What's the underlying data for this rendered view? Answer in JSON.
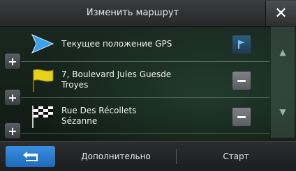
{
  "header": {
    "title": "Изменить маршрут",
    "close_label": "✕"
  },
  "route": {
    "points": [
      {
        "line1": "Текущее положение GPS",
        "line2": "",
        "icon": "gps-arrow-icon",
        "action": "flag-icon"
      },
      {
        "line1": "7, Boulevard Jules Guesde",
        "line2": "Troyes",
        "icon": "yellow-flag-icon",
        "action": "minus-icon"
      },
      {
        "line1": "Rue Des Récollets",
        "line2": "Sézanne",
        "icon": "checkered-flag-icon",
        "action": "minus-icon"
      }
    ],
    "add_label": "+"
  },
  "footer": {
    "back_icon": "back-arrow-icon",
    "more_label": "Дополнительно",
    "start_label": "Старт"
  },
  "colors": {
    "accent": "#2a7fd4",
    "flag_yellow": "#e6d21a",
    "gps_blue": "#3aa0e8"
  }
}
